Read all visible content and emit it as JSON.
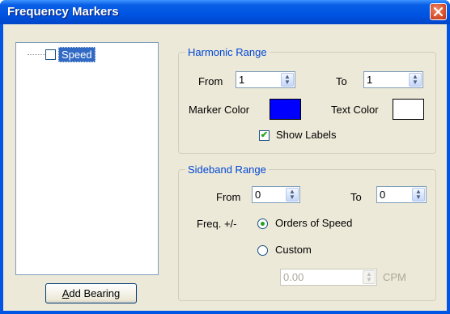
{
  "window": {
    "title": "Frequency Markers",
    "close_glyph": "✕"
  },
  "tree": {
    "items": [
      {
        "label": "Speed",
        "checked": false
      }
    ]
  },
  "buttons": {
    "add_bearing_accel": "A",
    "add_bearing_rest": "dd Bearing"
  },
  "harmonic": {
    "title": "Harmonic Range",
    "from_label": "From",
    "from_value": "1",
    "to_label": "To",
    "to_value": "1",
    "marker_color_label": "Marker Color",
    "marker_color": "#0000ff",
    "text_color_label": "Text Color",
    "text_color": "#ffffff",
    "show_labels_label": "Show Labels",
    "show_labels_checked": true
  },
  "sideband": {
    "title": "Sideband Range",
    "from_label": "From",
    "from_value": "0",
    "to_label": "To",
    "to_value": "0",
    "freq_label": "Freq. +/-",
    "orders_label": "Orders of Speed",
    "custom_label": "Custom",
    "custom_value": "0.00",
    "unit_label": "CPM",
    "selected_mode": "Orders of Speed"
  },
  "icons": {
    "spin_up": "▲",
    "spin_down": "▼",
    "check": "✔"
  }
}
